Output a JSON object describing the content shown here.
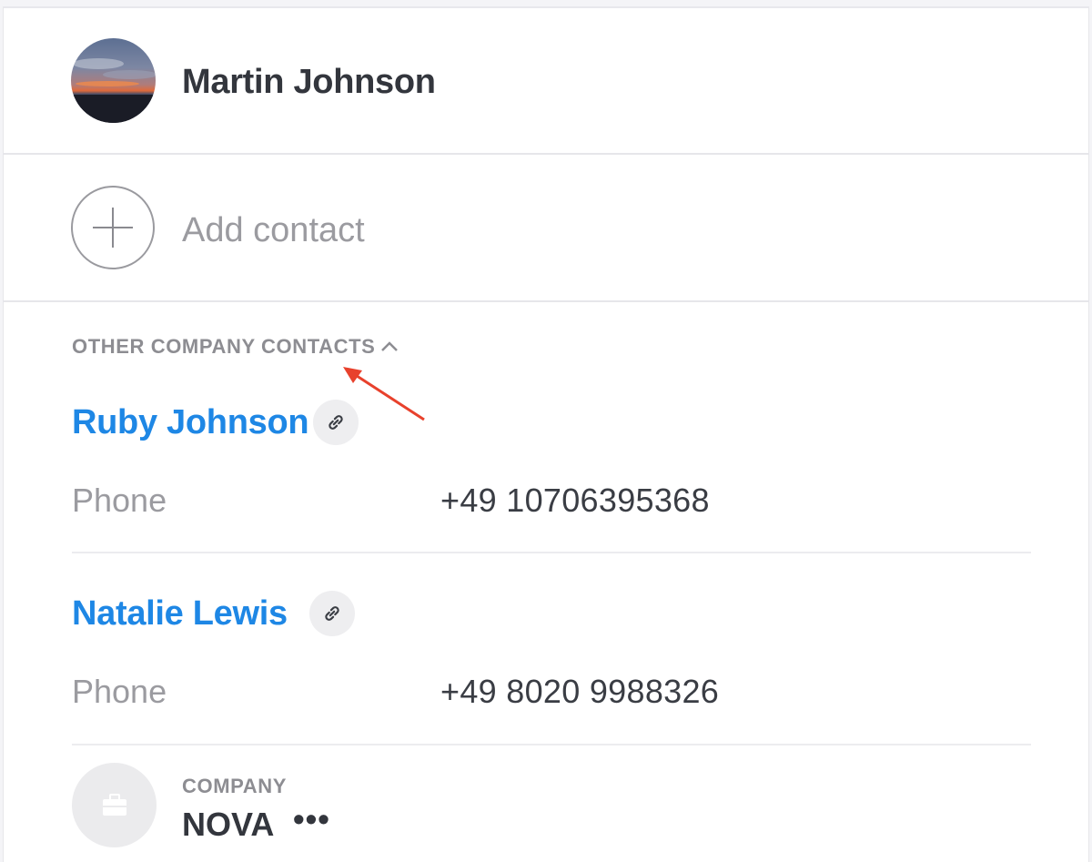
{
  "user": {
    "name": "Martin Johnson"
  },
  "add_contact": {
    "label": "Add contact"
  },
  "other_contacts": {
    "header": "OTHER COMPANY CONTACTS",
    "expanded": true,
    "contacts": [
      {
        "name": "Ruby Johnson",
        "phone_label": "Phone",
        "phone": "+49 10706395368"
      },
      {
        "name": "Natalie Lewis",
        "phone_label": "Phone",
        "phone": "+49 8020 9988326"
      }
    ]
  },
  "company": {
    "label": "COMPANY",
    "name": "NOVA",
    "more": "•••"
  },
  "icons": {
    "avatar": "avatar-image",
    "add": "plus-circle-icon",
    "chevron": "chevron-up-icon",
    "link": "link-icon",
    "company": "briefcase-icon",
    "more": "more-horizontal-icon"
  },
  "colors": {
    "contact_link": "#1e87e5",
    "annotation_arrow": "#e8412c"
  }
}
